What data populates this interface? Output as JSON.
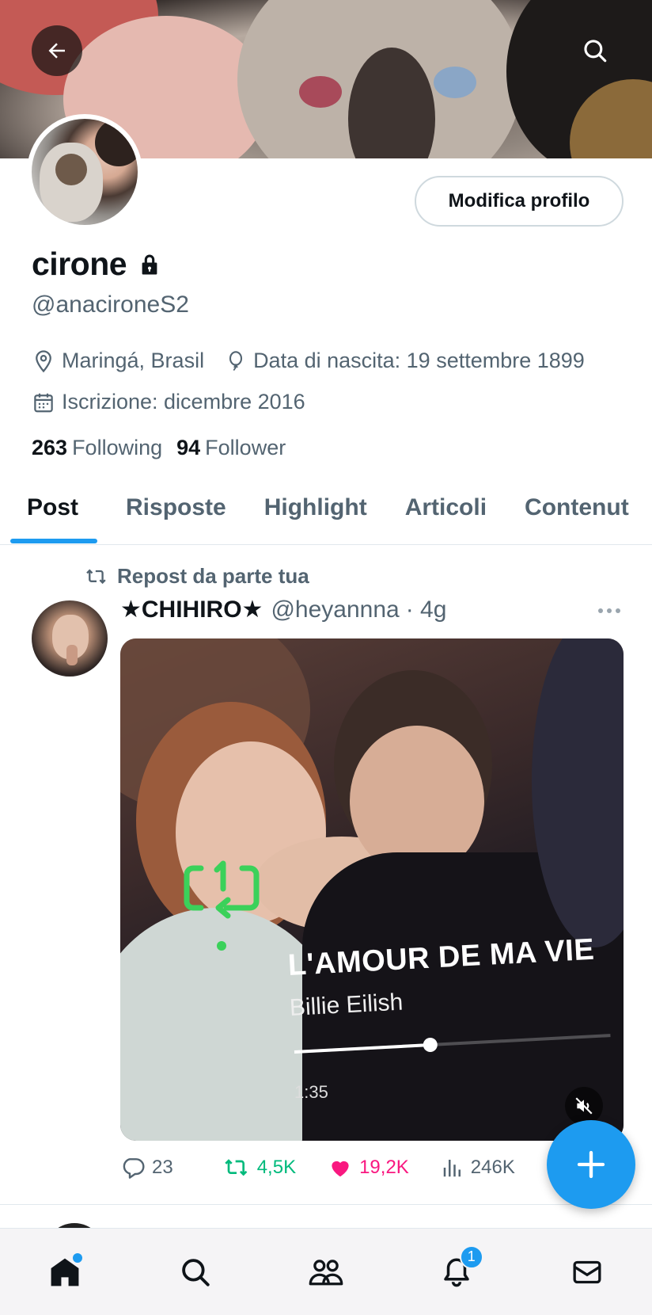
{
  "profile": {
    "name": "cirone",
    "handle": "@anacironeS2",
    "edit_label": "Modifica profilo",
    "location": "Maringá, Brasil",
    "birthday": "Data di nascita: 19 settembre 1899",
    "joined": "Iscrizione: dicembre 2016",
    "following_count": "263",
    "following_label": "Following",
    "followers_count": "94",
    "followers_label": "Follower"
  },
  "tabs": [
    {
      "label": "Post",
      "active": true
    },
    {
      "label": "Risposte",
      "active": false
    },
    {
      "label": "Highlight",
      "active": false
    },
    {
      "label": "Articoli",
      "active": false
    },
    {
      "label": "Contenut",
      "active": false
    }
  ],
  "post": {
    "repost_label": "Repost da parte tua",
    "author": "★CHIHIRO★",
    "handle": "@heyannna",
    "time": "· 4g",
    "media": {
      "song_title": "L'AMOUR DE MA VIE",
      "song_artist": "Billie Eilish",
      "elapsed": "1:35",
      "progress_fraction": 0.43
    },
    "replies": "23",
    "reposts": "4,5K",
    "likes": "19,2K",
    "views": "246K"
  },
  "nav": {
    "notifications_badge": "1"
  },
  "colors": {
    "accent": "#1d9bf0",
    "repost": "#00ba7c",
    "like": "#f91880",
    "secondary_text": "#536471"
  },
  "icons": [
    "back-arrow-icon",
    "search-icon",
    "lock-icon",
    "location-pin-icon",
    "balloon-icon",
    "calendar-icon",
    "repost-icon",
    "more-icon",
    "reply-icon",
    "like-icon",
    "views-icon",
    "share-icon",
    "plus-icon",
    "home-icon",
    "communities-icon",
    "bell-icon",
    "mail-icon",
    "mute-icon"
  ]
}
